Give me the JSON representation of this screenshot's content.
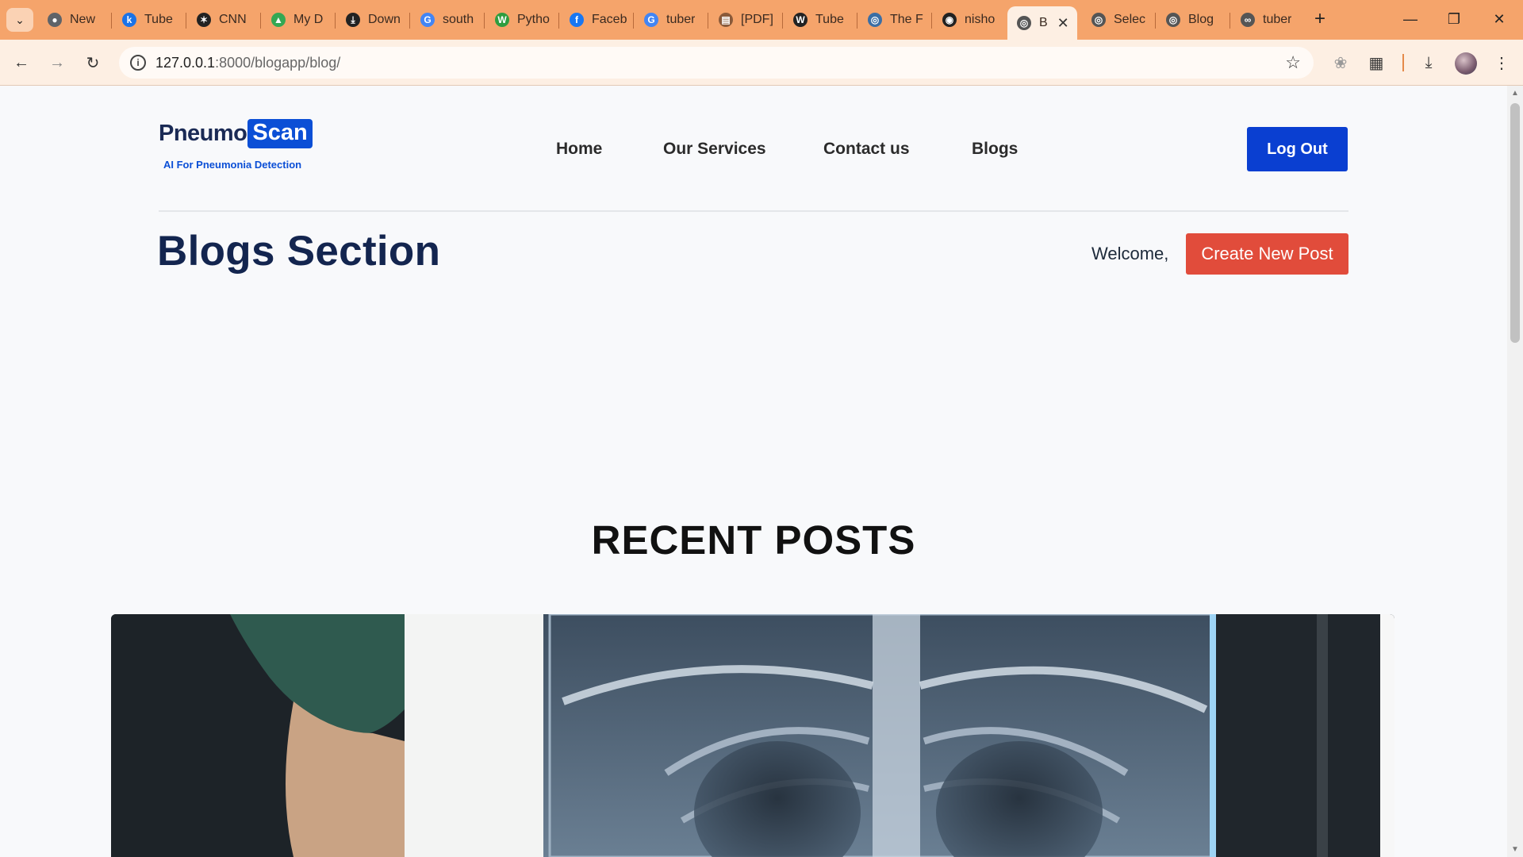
{
  "browser": {
    "tabs": [
      {
        "title": "New",
        "icon": "chrome-icon",
        "color": "#5f6368"
      },
      {
        "title": "Tube",
        "icon": "k-icon",
        "color": "#1a73e8"
      },
      {
        "title": "CNN",
        "icon": "openai-icon",
        "color": "#222222"
      },
      {
        "title": "My D",
        "icon": "drive-icon",
        "color": "#34a853"
      },
      {
        "title": "Down",
        "icon": "download-icon",
        "color": "#222222"
      },
      {
        "title": "south",
        "icon": "google-icon",
        "color": "#4285f4"
      },
      {
        "title": "Pytho",
        "icon": "w-icon",
        "color": "#2e9d3f"
      },
      {
        "title": "Faceb",
        "icon": "facebook-icon",
        "color": "#1877f2"
      },
      {
        "title": "tuber",
        "icon": "google-icon",
        "color": "#4285f4"
      },
      {
        "title": "[PDF]",
        "icon": "pdf-icon",
        "color": "#8a5a3a"
      },
      {
        "title": "Tube",
        "icon": "wikipedia-icon",
        "color": "#222222"
      },
      {
        "title": "The F",
        "icon": "globe-icon",
        "color": "#3a6ea5"
      },
      {
        "title": "nisho",
        "icon": "github-icon",
        "color": "#222222"
      },
      {
        "title": "B",
        "icon": "globe-icon",
        "color": "#555555"
      },
      {
        "title": "Selec",
        "icon": "globe-icon",
        "color": "#555555"
      },
      {
        "title": "Blog",
        "icon": "globe-icon",
        "color": "#555555"
      },
      {
        "title": "tuber",
        "icon": "link-icon",
        "color": "#555555"
      }
    ],
    "active_tab_index": 13,
    "url_host": "127.0.0.1",
    "url_rest": ":8000/blogapp/blog/"
  },
  "site": {
    "logo_part1": "Pneumo",
    "logo_part2": "Scan",
    "tagline": "AI For Pneumonia Detection",
    "nav": [
      "Home",
      "Our Services",
      "Contact us",
      "Blogs"
    ],
    "logout_label": "Log Out"
  },
  "blog": {
    "section_title": "Blogs Section",
    "welcome_text": "Welcome,",
    "create_post_label": "Create New Post",
    "recent_heading": "RECENT POSTS"
  },
  "colors": {
    "brand_blue": "#0b4fd6",
    "navy": "#13254f",
    "create_red": "#e14c3b",
    "tabstrip": "#f5a46b"
  }
}
